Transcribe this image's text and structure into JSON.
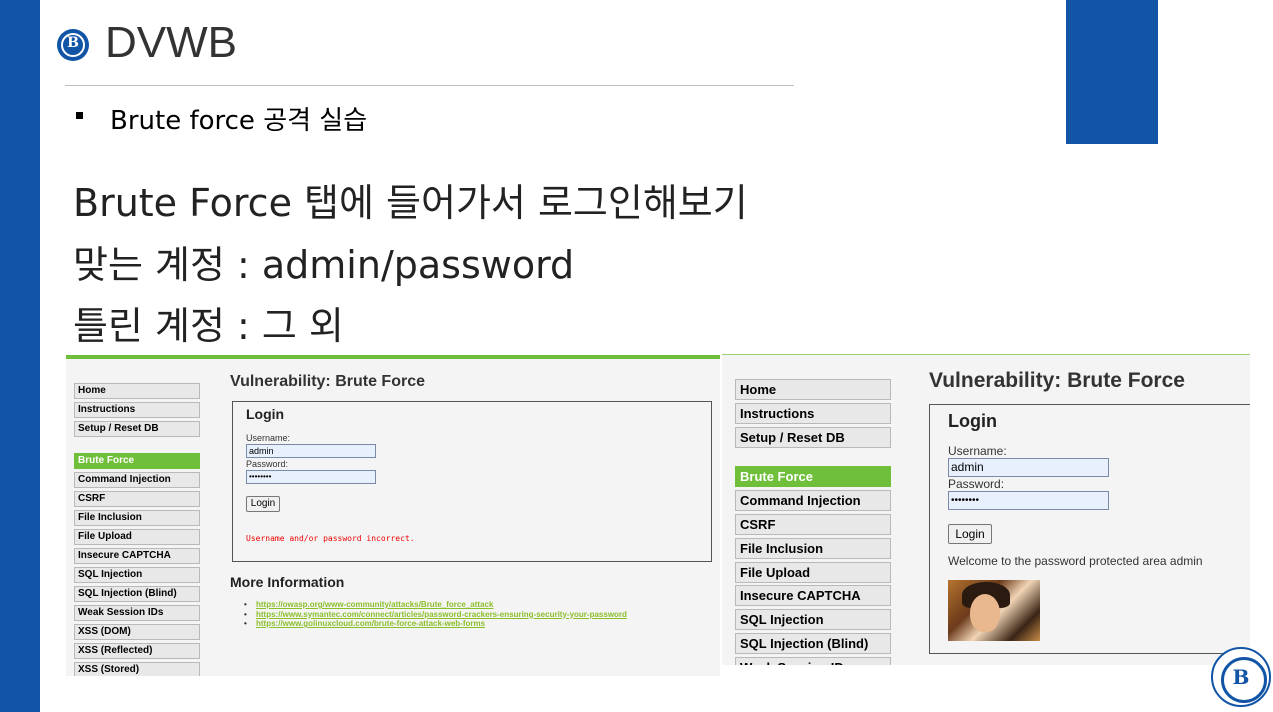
{
  "slide": {
    "title": "DVWB",
    "bullet": "Brute force 공격 실습",
    "lines": [
      "Brute Force 탭에 들어가서 로그인해보기",
      "맞는 계정 : admin/password",
      "틀린 계정 : 그 외"
    ],
    "accent_color": "#1254a6"
  },
  "screenshot_failed": {
    "menu": [
      "Home",
      "Instructions",
      "Setup / Reset DB",
      "Brute Force",
      "Command Injection",
      "CSRF",
      "File Inclusion",
      "File Upload",
      "Insecure CAPTCHA",
      "SQL Injection",
      "SQL Injection (Blind)",
      "Weak Session IDs",
      "XSS (DOM)",
      "XSS (Reflected)",
      "XSS (Stored)"
    ],
    "active_item": "Brute Force",
    "page_title": "Vulnerability: Brute Force",
    "login_title": "Login",
    "username_label": "Username:",
    "username_value": "admin",
    "password_label": "Password:",
    "password_value": "••••••••",
    "login_button": "Login",
    "message": "Username and/or password incorrect.",
    "more_title": "More Information",
    "links": [
      "https://owasp.org/www-community/attacks/Brute_force_attack",
      "https://www.symantec.com/connect/articles/password-crackers-ensuring-security-your-password",
      "https://www.golinuxcloud.com/brute-force-attack-web-forms"
    ]
  },
  "screenshot_success": {
    "menu": [
      "Home",
      "Instructions",
      "Setup / Reset DB",
      "Brute Force",
      "Command Injection",
      "CSRF",
      "File Inclusion",
      "File Upload",
      "Insecure CAPTCHA",
      "SQL Injection",
      "SQL Injection (Blind)",
      "Weak Session IDs"
    ],
    "active_item": "Brute Force",
    "page_title": "Vulnerability: Brute Force",
    "login_title": "Login",
    "username_label": "Username:",
    "username_value": "admin",
    "password_label": "Password:",
    "password_value": "••••••••",
    "login_button": "Login",
    "message": "Welcome to the password protected area admin"
  },
  "colors": {
    "dvwa_green": "#70bf3a",
    "error_red": "#e00000",
    "link_green": "#8bbf2a"
  }
}
